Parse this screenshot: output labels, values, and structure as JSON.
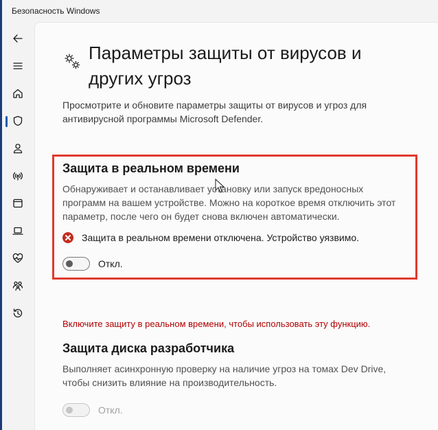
{
  "window": {
    "title": "Безопасность Windows"
  },
  "nav": {
    "items": [
      {
        "name": "back-arrow-icon",
        "selected": false
      },
      {
        "name": "menu-icon",
        "selected": false
      },
      {
        "name": "home-icon",
        "selected": false
      },
      {
        "name": "shield-icon",
        "selected": true
      },
      {
        "name": "person-icon",
        "selected": false
      },
      {
        "name": "wifi-antenna-icon",
        "selected": false
      },
      {
        "name": "app-browser-icon",
        "selected": false
      },
      {
        "name": "laptop-icon",
        "selected": false
      },
      {
        "name": "heart-pulse-icon",
        "selected": false
      },
      {
        "name": "family-icon",
        "selected": false
      },
      {
        "name": "history-icon",
        "selected": false
      }
    ]
  },
  "page": {
    "header_icon": "gears-icon",
    "title": "Параметры защиты от вирусов и других угроз",
    "description": "Просмотрите и обновите параметры защиты от вирусов и угроз для антивирусной программы Microsoft Defender."
  },
  "realtime": {
    "title": "Защита в реальном времени",
    "description": "Обнаруживает и останавливает установку или запуск вредоносных программ на вашем устройстве. Можно на короткое время отключить этот параметр, после чего он будет снова включен автоматически.",
    "status_icon": "error-circle-icon",
    "status": "Защита в реальном времени отключена. Устройство уязвимо.",
    "toggle_label": "Откл.",
    "toggle_on": false
  },
  "dev_drive": {
    "warning": "Включите защиту в реальном времени, чтобы использовать эту функцию.",
    "title": "Защита диска разработчика",
    "description": "Выполняет асинхронную проверку на наличие угроз на томах Dev Drive, чтобы снизить влияние на производительность.",
    "toggle_label": "Откл.",
    "toggle_on": false,
    "toggle_enabled": false
  },
  "colors": {
    "highlight_border": "#e03a2e",
    "error": "#c42b1c",
    "warning_text": "#b00000",
    "accent": "#0f5bb5"
  }
}
